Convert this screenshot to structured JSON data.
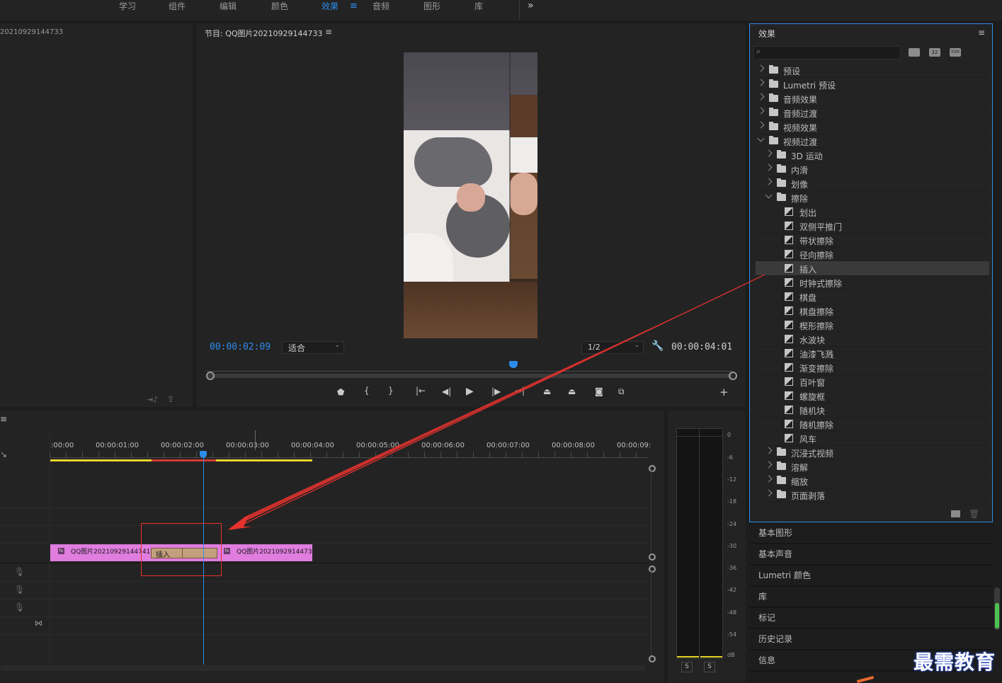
{
  "workspace_tabs": [
    "学习",
    "组件",
    "编辑",
    "颜色",
    "效果",
    "音频",
    "图形",
    "库"
  ],
  "workspace_active_index": 4,
  "workspace_overflow": "»",
  "source_panel": {
    "title": "20210929144733"
  },
  "program_monitor": {
    "title": "节目: QQ图片20210929144733",
    "timecode_current": "00:00:02:09",
    "fit_option": "适合",
    "resolution": "1/2",
    "timecode_duration": "00:00:04:01"
  },
  "timeline": {
    "ruler_labels": [
      ":00:00",
      "00:00:01:00",
      "00:00:02:00",
      "00:00:03:00",
      "00:00:04:00",
      "00:00:05:00",
      "00:00:06:00",
      "00:00:07:00",
      "00:00:08:00",
      "00:00:09:"
    ],
    "playhead_fraction": 0.265,
    "clip_a_label": "QQ图片20210929144741.",
    "transition_label": "插入",
    "clip_b_label": "QQ图片2021092914473",
    "fx_badge": "fx"
  },
  "audio_meter": {
    "scale": [
      "0",
      "-6",
      "-12",
      "-18",
      "-24",
      "-30",
      "-36",
      "-42",
      "-48",
      "-54",
      "dB"
    ],
    "solo_labels": [
      "S",
      "S"
    ]
  },
  "effects_panel": {
    "title": "效果",
    "search_placeholder": "",
    "filter_badges": [
      "32",
      "YUV"
    ],
    "tree": [
      {
        "label": "预设",
        "level": 0,
        "kind": "preset",
        "expanded": false
      },
      {
        "label": "Lumetri 预设",
        "level": 0,
        "kind": "preset",
        "expanded": false
      },
      {
        "label": "音频效果",
        "level": 0,
        "kind": "folder",
        "expanded": false
      },
      {
        "label": "音频过渡",
        "level": 0,
        "kind": "folder",
        "expanded": false
      },
      {
        "label": "视频效果",
        "level": 0,
        "kind": "folder",
        "expanded": false
      },
      {
        "label": "视频过渡",
        "level": 0,
        "kind": "folder",
        "expanded": true
      },
      {
        "label": "3D 运动",
        "level": 1,
        "kind": "folder",
        "expanded": false
      },
      {
        "label": "内滑",
        "level": 1,
        "kind": "folder",
        "expanded": false
      },
      {
        "label": "划像",
        "level": 1,
        "kind": "folder",
        "expanded": false
      },
      {
        "label": "擦除",
        "level": 1,
        "kind": "folder",
        "expanded": true
      },
      {
        "label": "划出",
        "level": 2,
        "kind": "item"
      },
      {
        "label": "双侧平推门",
        "level": 2,
        "kind": "item"
      },
      {
        "label": "带状擦除",
        "level": 2,
        "kind": "item"
      },
      {
        "label": "径向擦除",
        "level": 2,
        "kind": "item"
      },
      {
        "label": "插入",
        "level": 2,
        "kind": "item",
        "selected": true
      },
      {
        "label": "时钟式擦除",
        "level": 2,
        "kind": "item"
      },
      {
        "label": "棋盘",
        "level": 2,
        "kind": "item"
      },
      {
        "label": "棋盘擦除",
        "level": 2,
        "kind": "item"
      },
      {
        "label": "楔形擦除",
        "level": 2,
        "kind": "item"
      },
      {
        "label": "水波块",
        "level": 2,
        "kind": "item"
      },
      {
        "label": "油漆飞溅",
        "level": 2,
        "kind": "item"
      },
      {
        "label": "渐变擦除",
        "level": 2,
        "kind": "item"
      },
      {
        "label": "百叶窗",
        "level": 2,
        "kind": "item"
      },
      {
        "label": "螺旋框",
        "level": 2,
        "kind": "item"
      },
      {
        "label": "随机块",
        "level": 2,
        "kind": "item"
      },
      {
        "label": "随机擦除",
        "level": 2,
        "kind": "item"
      },
      {
        "label": "风车",
        "level": 2,
        "kind": "item"
      },
      {
        "label": "沉浸式视频",
        "level": 1,
        "kind": "folder",
        "expanded": false
      },
      {
        "label": "溶解",
        "level": 1,
        "kind": "folder",
        "expanded": false
      },
      {
        "label": "缩放",
        "level": 1,
        "kind": "folder",
        "expanded": false
      },
      {
        "label": "页面剥落",
        "level": 1,
        "kind": "folder",
        "expanded": false
      }
    ]
  },
  "side_panels": [
    "基本图形",
    "基本声音",
    "Lumetri 颜色",
    "库",
    "标记",
    "历史记录",
    "信息"
  ],
  "watermark": "最需教育",
  "colors": {
    "accent": "#2d8ceb",
    "clip": "#e07ddf",
    "transition": "#c2a07d",
    "annotation": "#e8322e"
  }
}
